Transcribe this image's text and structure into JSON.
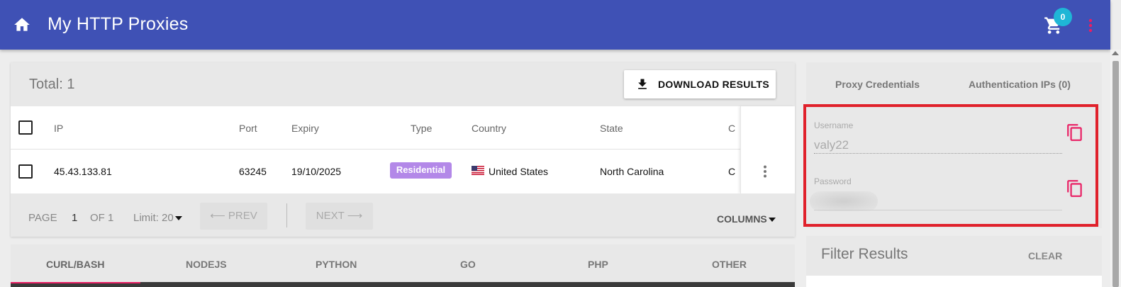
{
  "appbar": {
    "title": "My HTTP Proxies",
    "cart_count": "0",
    "color": "#3f51b5"
  },
  "results": {
    "total_label": "Total: 1",
    "download_label": "DOWNLOAD RESULTS",
    "columns": [
      "IP",
      "Port",
      "Expiry",
      "Type",
      "Country",
      "State",
      "C"
    ],
    "rows": [
      {
        "ip": "45.43.133.81",
        "port": "63245",
        "expiry": "19/10/2025",
        "type": "Residential",
        "country": "United States",
        "country_flag": "us-flag-icon",
        "state": "North Carolina",
        "c": "C"
      }
    ]
  },
  "pager": {
    "page_label": "PAGE",
    "page_num": "1",
    "of_label": "OF 1",
    "limit_label": "Limit: 20",
    "prev_label": "⟵ PREV",
    "next_label": "NEXT ⟶",
    "columns_label": "COLUMNS"
  },
  "code_tabs": {
    "tabs": [
      "CURL/BASH",
      "NODEJS",
      "PYTHON",
      "GO",
      "PHP",
      "OTHER"
    ],
    "active": "CURL/BASH",
    "accent": "#e91e63"
  },
  "credentials": {
    "tabs": [
      "Proxy Credentials",
      "Authentication IPs (0)"
    ],
    "username_label": "Username",
    "username_value": "valy22",
    "password_label": "Password",
    "highlight_color": "#e0212b",
    "copy_icon_color": "#e91e63"
  },
  "filter": {
    "title": "Filter Results",
    "clear_label": "CLEAR"
  },
  "colors": {
    "type_chip": "#b388e8",
    "badge": "#1fb6d6"
  }
}
